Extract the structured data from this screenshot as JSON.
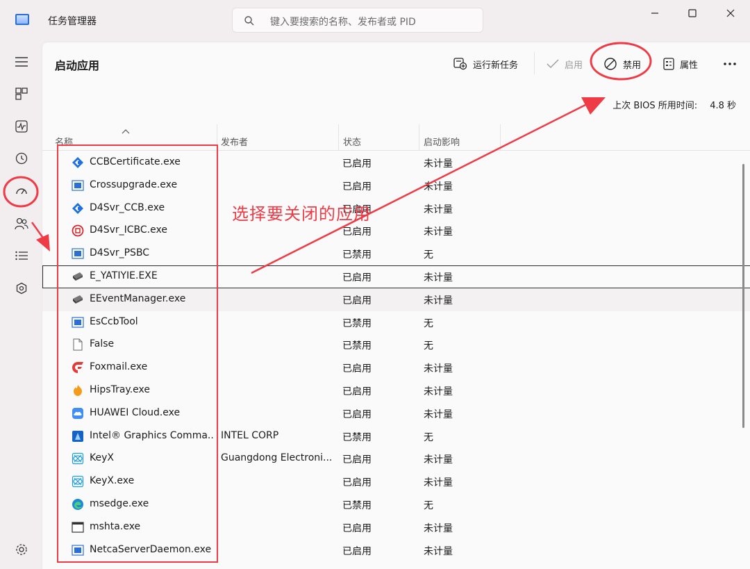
{
  "app": {
    "title": "任务管理器"
  },
  "search": {
    "placeholder": "键入要搜索的名称、发布者或 PID"
  },
  "page": {
    "title": "启动应用"
  },
  "toolbar": {
    "run_new_task": "运行新任务",
    "enable": "启用",
    "disable": "禁用",
    "properties": "属性"
  },
  "bios": {
    "label": "上次 BIOS 所用时间:",
    "value": "4.8 秒"
  },
  "columns": {
    "name": "名称",
    "publisher": "发布者",
    "status": "状态",
    "impact": "启动影响"
  },
  "rows": [
    {
      "name": "CCBCertificate.exe",
      "publisher": "",
      "status": "已启用",
      "impact": "未计量",
      "icon": "ccb-icon"
    },
    {
      "name": "Crossupgrade.exe",
      "publisher": "",
      "status": "已启用",
      "impact": "未计量",
      "icon": "window-app-icon"
    },
    {
      "name": "D4Svr_CCB.exe",
      "publisher": "",
      "status": "已启用",
      "impact": "未计量",
      "icon": "ccb-icon"
    },
    {
      "name": "D4Svr_ICBC.exe",
      "publisher": "",
      "status": "已启用",
      "impact": "未计量",
      "icon": "icbc-icon"
    },
    {
      "name": "D4Svr_PSBC",
      "publisher": "",
      "status": "已禁用",
      "impact": "无",
      "icon": "window-app-icon"
    },
    {
      "name": "E_YATIYIE.EXE",
      "publisher": "",
      "status": "已启用",
      "impact": "未计量",
      "icon": "printer-icon"
    },
    {
      "name": "EEventManager.exe",
      "publisher": "",
      "status": "已启用",
      "impact": "未计量",
      "icon": "printer-icon"
    },
    {
      "name": "EsCcbTool",
      "publisher": "",
      "status": "已禁用",
      "impact": "无",
      "icon": "window-app-icon"
    },
    {
      "name": "False",
      "publisher": "",
      "status": "已禁用",
      "impact": "无",
      "icon": "file-icon"
    },
    {
      "name": "Foxmail.exe",
      "publisher": "",
      "status": "已启用",
      "impact": "未计量",
      "icon": "foxmail-icon"
    },
    {
      "name": "HipsTray.exe",
      "publisher": "",
      "status": "已启用",
      "impact": "未计量",
      "icon": "shield-icon"
    },
    {
      "name": "HUAWEI Cloud.exe",
      "publisher": "",
      "status": "已启用",
      "impact": "未计量",
      "icon": "cloud-icon"
    },
    {
      "name": "Intel® Graphics Comma...",
      "publisher": "INTEL CORP",
      "status": "已禁用",
      "impact": "无",
      "icon": "intel-icon"
    },
    {
      "name": "KeyX",
      "publisher": "Guangdong Electroni...",
      "status": "已启用",
      "impact": "未计量",
      "icon": "keyx-icon"
    },
    {
      "name": "KeyX.exe",
      "publisher": "",
      "status": "已启用",
      "impact": "未计量",
      "icon": "keyx-icon"
    },
    {
      "name": "msedge.exe",
      "publisher": "",
      "status": "已禁用",
      "impact": "无",
      "icon": "edge-icon"
    },
    {
      "name": "mshta.exe",
      "publisher": "",
      "status": "已启用",
      "impact": "未计量",
      "icon": "window-frame-icon"
    },
    {
      "name": "NetcaServerDaemon.exe",
      "publisher": "",
      "status": "已启用",
      "impact": "未计量",
      "icon": "window-app-icon"
    }
  ],
  "annotation": {
    "text": "选择要关闭的应用"
  },
  "colors": {
    "annotation_red": "#ee3b46",
    "accent_blue": "#2a6fd6"
  }
}
